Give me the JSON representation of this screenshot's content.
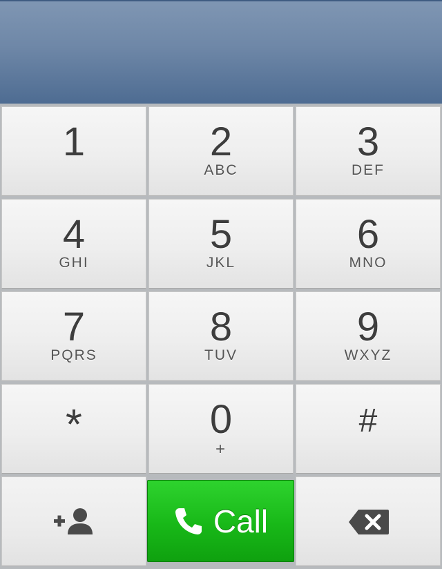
{
  "display": {
    "number": ""
  },
  "keys": [
    {
      "digit": "1",
      "letters": ""
    },
    {
      "digit": "2",
      "letters": "ABC"
    },
    {
      "digit": "3",
      "letters": "DEF"
    },
    {
      "digit": "4",
      "letters": "GHI"
    },
    {
      "digit": "5",
      "letters": "JKL"
    },
    {
      "digit": "6",
      "letters": "MNO"
    },
    {
      "digit": "7",
      "letters": "PQRS"
    },
    {
      "digit": "8",
      "letters": "TUV"
    },
    {
      "digit": "9",
      "letters": "WXYZ"
    },
    {
      "digit": "*",
      "letters": ""
    },
    {
      "digit": "0",
      "letters": "+"
    },
    {
      "digit": "#",
      "letters": ""
    }
  ],
  "actions": {
    "add_contact_icon": "add-contact-icon",
    "call_label": "Call",
    "call_icon": "phone-icon",
    "delete_icon": "backspace-icon"
  },
  "colors": {
    "header": "#6e87a7",
    "call_green": "#18b818",
    "key_text": "#3d3d3d"
  }
}
